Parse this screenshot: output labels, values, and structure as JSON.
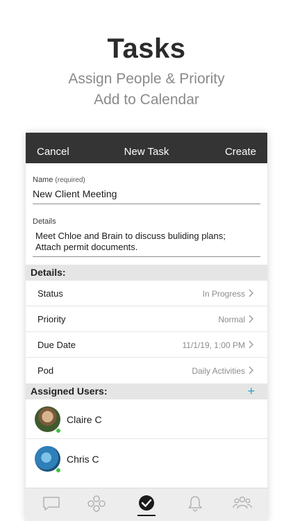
{
  "promo": {
    "title": "Tasks",
    "subtitle_line1": "Assign People & Priority",
    "subtitle_line2": "Add to Calendar"
  },
  "navbar": {
    "cancel_label": "Cancel",
    "title": "New Task",
    "create_label": "Create"
  },
  "form": {
    "name_label": "Name",
    "name_required": "(required)",
    "name_value": "New Client Meeting",
    "details_label": "Details",
    "details_line1": "Meet Chloe and Brain to discuss buliding plans;",
    "details_line2": "Attach permit documents."
  },
  "details_section": {
    "header": "Details:",
    "rows": [
      {
        "label": "Status",
        "value": "In Progress"
      },
      {
        "label": "Priority",
        "value": "Normal"
      },
      {
        "label": "Due Date",
        "value": "11/1/19, 1:00 PM"
      },
      {
        "label": "Pod",
        "value": "Daily Activities"
      }
    ]
  },
  "assigned_section": {
    "header": "Assigned Users:",
    "add_label": "+",
    "users": [
      {
        "name": "Claire C",
        "status": "online"
      },
      {
        "name": "Chris C",
        "status": "online"
      }
    ]
  },
  "tabbar": {
    "tabs": [
      {
        "icon": "chat-bubble-icon",
        "active": false
      },
      {
        "icon": "pods-icon",
        "active": false
      },
      {
        "icon": "checkmark-circle-icon",
        "active": true
      },
      {
        "icon": "bell-icon",
        "active": false
      },
      {
        "icon": "people-icon",
        "active": false
      }
    ]
  },
  "colors": {
    "navbar_bg": "#343434",
    "section_bg": "#e5e5e5",
    "accent": "#2ea3c4",
    "online": "#3fc33f",
    "secondary_text": "#8c8c8c"
  }
}
